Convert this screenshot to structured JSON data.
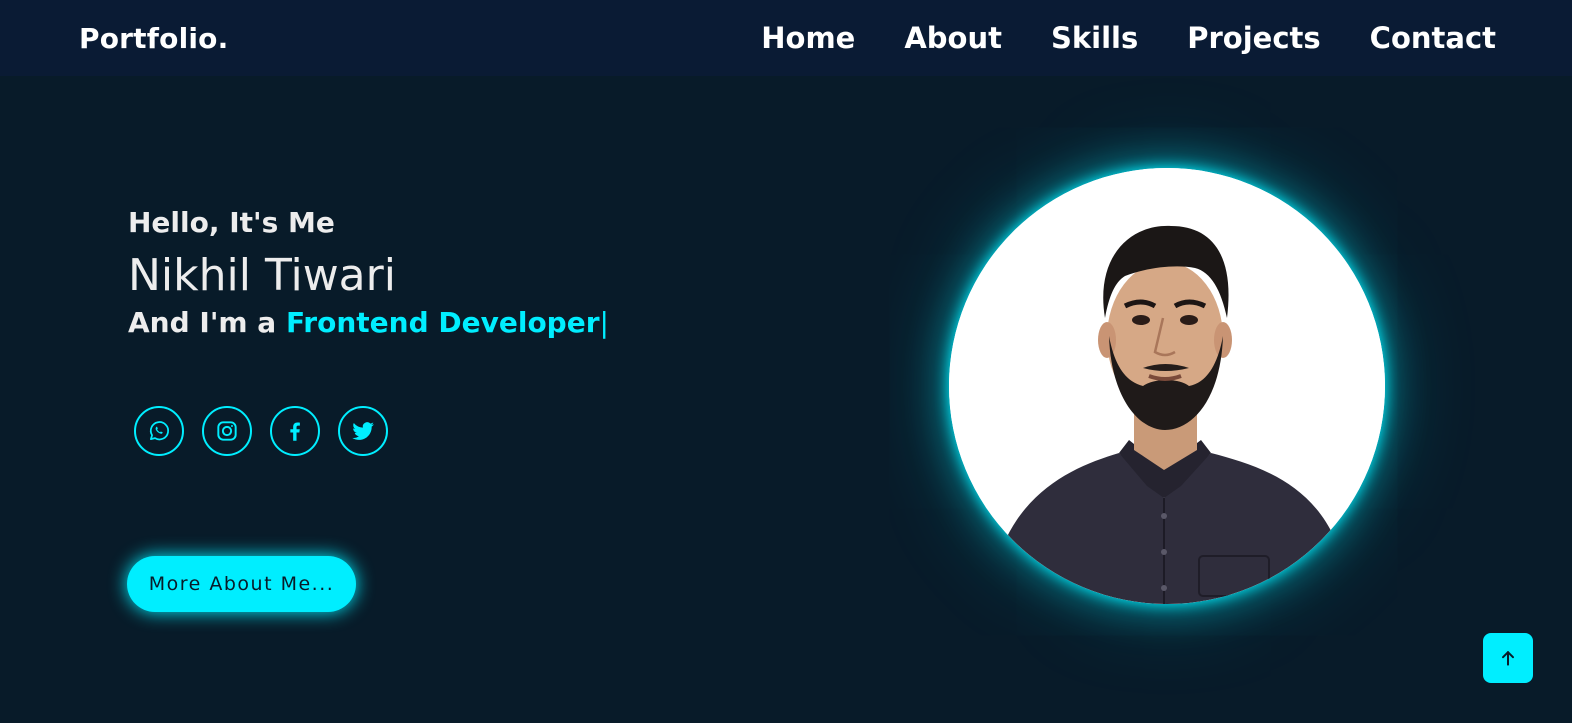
{
  "header": {
    "logo": "Portfolio.",
    "nav": [
      "Home",
      "About",
      "Skills",
      "Projects",
      "Contact"
    ]
  },
  "hero": {
    "greeting": "Hello, It's Me",
    "name": "Nikhil Tiwari",
    "role_prefix": "And I'm a ",
    "role_highlight": "Frontend Developer",
    "cursor": "|",
    "button_label": "More About Me...",
    "socials": [
      "whatsapp-icon",
      "instagram-icon",
      "facebook-icon",
      "twitter-icon"
    ]
  },
  "colors": {
    "background": "#081b29",
    "header_bg": "#0a1b34",
    "accent": "#00eeff",
    "text": "#ededed"
  },
  "scroll_top_icon": "arrow-up-icon"
}
